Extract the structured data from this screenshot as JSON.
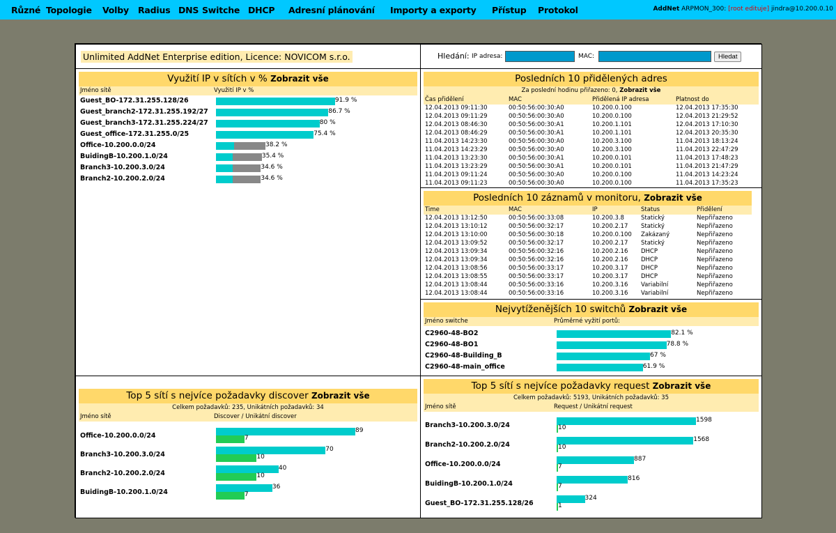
{
  "menu": {
    "items": [
      "Různé",
      "Topologie",
      "Volby",
      "Radius",
      "DNS",
      "Switche",
      "DHCP",
      "Adresní plánování",
      "Importy a exporty",
      "Přístup",
      "Protokol"
    ]
  },
  "user": {
    "app": "AddNet",
    "db": "ARPMON_300:",
    "role": "[root edituje]",
    "login": "jindra@10.200.0.10"
  },
  "licence": "Unlimited AddNet Enterprise edition, Licence: NOVICOM s.r.o.",
  "search": {
    "label": "Hledání:",
    "ip_label": "IP adresa:",
    "mac_label": "MAC:",
    "button": "Hledat",
    "ip_value": "",
    "mac_value": ""
  },
  "util": {
    "title": "Využití IP v sítích v %",
    "link": "Zobrazit vše",
    "col1": "Jméno sítě",
    "col2": "Využití IP v %",
    "rows": [
      {
        "name": "Guest_BO-172.31.255.128/26",
        "pct": 91.9,
        "label": "91.9 %"
      },
      {
        "name": "Guest_branch2-172.31.255.192/27",
        "pct": 86.7,
        "label": "86.7 %"
      },
      {
        "name": "Guest_branch3-172.31.255.224/27",
        "pct": 80,
        "label": "80 %"
      },
      {
        "name": "Guest_office-172.31.255.0/25",
        "pct": 75.4,
        "label": "75.4 %"
      },
      {
        "name": "Office-10.200.0.0/24",
        "pct": 38.2,
        "label": "38.2 %"
      },
      {
        "name": "BuidingB-10.200.1.0/24",
        "pct": 35.4,
        "label": "35.4 %"
      },
      {
        "name": "Branch3-10.200.3.0/24",
        "pct": 34.6,
        "label": "34.6 %"
      },
      {
        "name": "Branch2-10.200.2.0/24",
        "pct": 34.6,
        "label": "34.6 %"
      }
    ]
  },
  "last10": {
    "title": "Posledních 10 přidělených adres",
    "sub_text": "Za poslední hodinu přiřazeno: 0,",
    "sub_link": "Zobrazit vše",
    "cols": [
      "Čas přidělení",
      "MAC",
      "Přidělená IP adresa",
      "Platnost do"
    ],
    "rows": [
      [
        "12.04.2013 09:11:30",
        "00:50:56:00:30:A0",
        "10.200.0.100",
        "12.04.2013 17:35:30"
      ],
      [
        "12.04.2013 09:11:29",
        "00:50:56:00:30:A0",
        "10.200.0.100",
        "12.04.2013 21:29:52"
      ],
      [
        "12.04.2013 08:46:30",
        "00:50:56:00:30:A1",
        "10.200.1.101",
        "12.04.2013 17:10:30"
      ],
      [
        "12.04.2013 08:46:29",
        "00:50:56:00:30:A1",
        "10.200.1.101",
        "12.04.2013 20:35:30"
      ],
      [
        "11.04.2013 14:23:30",
        "00:50:56:00:30:A0",
        "10.200.3.100",
        "11.04.2013 18:13:24"
      ],
      [
        "11.04.2013 14:23:29",
        "00:50:56:00:30:A0",
        "10.200.3.100",
        "11.04.2013 22:47:29"
      ],
      [
        "11.04.2013 13:23:30",
        "00:50:56:00:30:A1",
        "10.200.0.101",
        "11.04.2013 17:48:23"
      ],
      [
        "11.04.2013 13:23:29",
        "00:50:56:00:30:A1",
        "10.200.0.101",
        "11.04.2013 21:47:29"
      ],
      [
        "11.04.2013 09:11:24",
        "00:50:56:00:30:A0",
        "10.200.0.100",
        "11.04.2013 14:23:24"
      ],
      [
        "11.04.2013 09:11:23",
        "00:50:56:00:30:A0",
        "10.200.0.100",
        "11.04.2013 17:35:23"
      ]
    ]
  },
  "monitor": {
    "title": "Posledních 10 záznamů v monitoru,",
    "link": "Zobrazit vše",
    "cols": [
      "Time",
      "MAC",
      "IP",
      "Status",
      "Přidělení"
    ],
    "rows": [
      [
        "12.04.2013 13:12:50",
        "00:50:56:00:33:08",
        "10.200.3.8",
        "Statický",
        "Nepřiřazeno"
      ],
      [
        "12.04.2013 13:10:12",
        "00:50:56:00:32:17",
        "10.200.2.17",
        "Statický",
        "Nepřiřazeno"
      ],
      [
        "12.04.2013 13:10:00",
        "00:50:56:00:30:18",
        "10.200.0.100",
        "Zakázaný",
        "Nepřiřazeno"
      ],
      [
        "12.04.2013 13:09:52",
        "00:50:56:00:32:17",
        "10.200.2.17",
        "Statický",
        "Nepřiřazeno"
      ],
      [
        "12.04.2013 13:09:34",
        "00:50:56:00:32:16",
        "10.200.2.16",
        "DHCP",
        "Nepřiřazeno"
      ],
      [
        "12.04.2013 13:09:34",
        "00:50:56:00:32:16",
        "10.200.2.16",
        "DHCP",
        "Nepřiřazeno"
      ],
      [
        "12.04.2013 13:08:56",
        "00:50:56:00:33:17",
        "10.200.3.17",
        "DHCP",
        "Nepřiřazeno"
      ],
      [
        "12.04.2013 13:08:55",
        "00:50:56:00:33:17",
        "10.200.3.17",
        "DHCP",
        "Nepřiřazeno"
      ],
      [
        "12.04.2013 13:08:44",
        "00:50:56:00:33:16",
        "10.200.3.16",
        "Variabilní",
        "Nepřiřazeno"
      ],
      [
        "12.04.2013 13:08:44",
        "00:50:56:00:33:16",
        "10.200.3.16",
        "Variabilní",
        "Nepřiřazeno"
      ]
    ]
  },
  "switches": {
    "title": "Nejvytíženějších 10 switchů",
    "link": "Zobrazit vše",
    "col1": "Jméno switche",
    "col2": "Průměrné vyžití portů:",
    "rows": [
      {
        "name": "C2960-48-BO2",
        "pct": 82.1,
        "label": "82.1 %"
      },
      {
        "name": "C2960-48-BO1",
        "pct": 78.8,
        "label": "78.8 %"
      },
      {
        "name": "C2960-48-Building_B",
        "pct": 67,
        "label": "67 %"
      },
      {
        "name": "C2960-48-main_office",
        "pct": 61.9,
        "label": "61.9 %"
      }
    ]
  },
  "discover": {
    "title": "Top 5 sítí s nejvíce požadavky discover",
    "link": "Zobrazit vše",
    "sub": "Celkem požadavků: 235, Unikátních požadavků: 34",
    "col1": "Jméno sítě",
    "col2": "Discover / Unikátní discover",
    "rows": [
      {
        "name": "Office-10.200.0.0/24",
        "total": 89,
        "unique": 7
      },
      {
        "name": "Branch3-10.200.3.0/24",
        "total": 70,
        "unique": 10
      },
      {
        "name": "Branch2-10.200.2.0/24",
        "total": 40,
        "unique": 10
      },
      {
        "name": "BuidingB-10.200.1.0/24",
        "total": 36,
        "unique": 7
      }
    ]
  },
  "request": {
    "title": "Top 5 sítí s nejvíce požadavky request",
    "link": "Zobrazit vše",
    "sub": "Celkem požadavků: 5193, Unikátních požadavků: 35",
    "col1": "Jméno sítě",
    "col2": "Request / Unikátní request",
    "rows": [
      {
        "name": "Branch3-10.200.3.0/24",
        "total": 1598,
        "unique": 10
      },
      {
        "name": "Branch2-10.200.2.0/24",
        "total": 1568,
        "unique": 10
      },
      {
        "name": "Office-10.200.0.0/24",
        "total": 887,
        "unique": 7
      },
      {
        "name": "BuidingB-10.200.1.0/24",
        "total": 816,
        "unique": 7
      },
      {
        "name": "Guest_BO-172.31.255.128/26",
        "total": 324,
        "unique": 1
      }
    ]
  },
  "colors": {
    "menubar": "#00c8ff",
    "header": "#ffd86a",
    "subheader": "#ffecb0",
    "bar": "#00cccc",
    "bar_gray": "#888888",
    "bar_green": "#22cc55",
    "background": "#7c7c6c"
  }
}
